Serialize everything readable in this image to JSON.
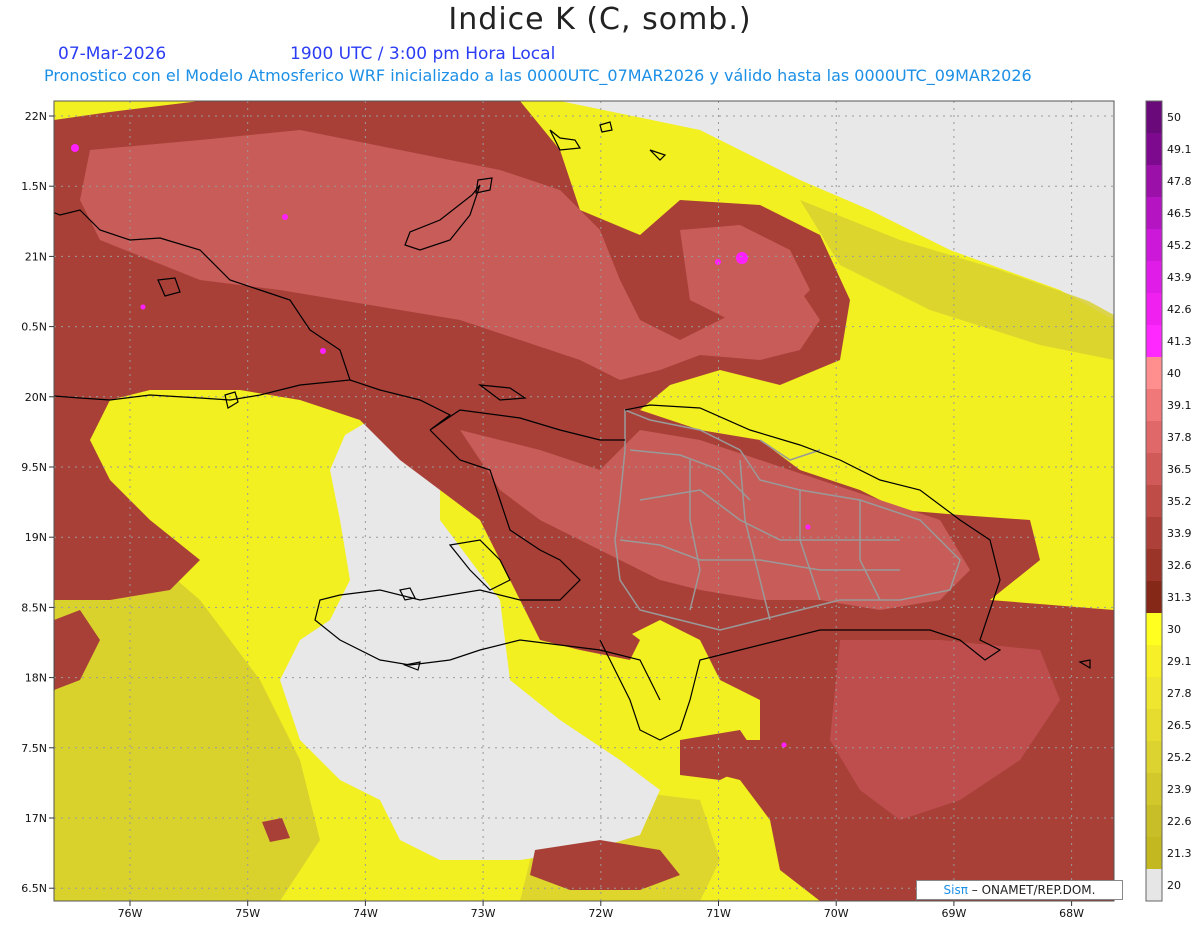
{
  "header": {
    "title": "Indice K (C, somb.)",
    "date": "07-Mar-2026",
    "time": "1900 UTC / 3:00 pm Hora Local",
    "subtitle": "Pronostico con el Modelo Atmosferico WRF inicializado a las 0000UTC_07MAR2026 y válido hasta las  0000UTC_09MAR2026"
  },
  "map": {
    "lat_labels": [
      "22N",
      "1.5N",
      "21N",
      "0.5N",
      "20N",
      "9.5N",
      "19N",
      "8.5N",
      "18N",
      "7.5N",
      "17N",
      "6.5N"
    ],
    "lon_labels": [
      "76W",
      "75W",
      "74W",
      "73W",
      "72W",
      "71W",
      "70W",
      "69W",
      "68W"
    ]
  },
  "colorbar": {
    "labels": [
      "50",
      "49.1",
      "47.8",
      "46.5",
      "45.2",
      "43.9",
      "42.6",
      "41.3",
      "40",
      "39.1",
      "37.8",
      "36.5",
      "35.2",
      "33.9",
      "32.6",
      "31.3",
      "30",
      "29.1",
      "27.8",
      "26.5",
      "25.2",
      "23.9",
      "22.6",
      "21.3",
      "20"
    ],
    "colors": [
      "#6a0a7a",
      "#7d0a8e",
      "#9a10a8",
      "#b414c2",
      "#cc18d8",
      "#e01ce8",
      "#f020f0",
      "#ff28ff",
      "#ff8f8f",
      "#f07878",
      "#e06868",
      "#d05a58",
      "#c04c48",
      "#ad4038",
      "#9a3428",
      "#862818",
      "#ffff20",
      "#f7f028",
      "#efe630",
      "#e6dc30",
      "#dcd230",
      "#d2c82c",
      "#c8be28",
      "#c4b820",
      "#e6e6e6"
    ]
  },
  "credit": {
    "sis": "Sisπ",
    "org": "– ONAMET/REP.DOM."
  },
  "colors": {
    "background": "#e8e8e8",
    "low_k": "#e8e8e8",
    "yellow": "#f2f020",
    "olive": "#d8d030",
    "brown": "#a84038",
    "salmon": "#c85c58",
    "magenta": "#ff20ff",
    "coast": "#000000",
    "province": "#9a9a9a"
  }
}
